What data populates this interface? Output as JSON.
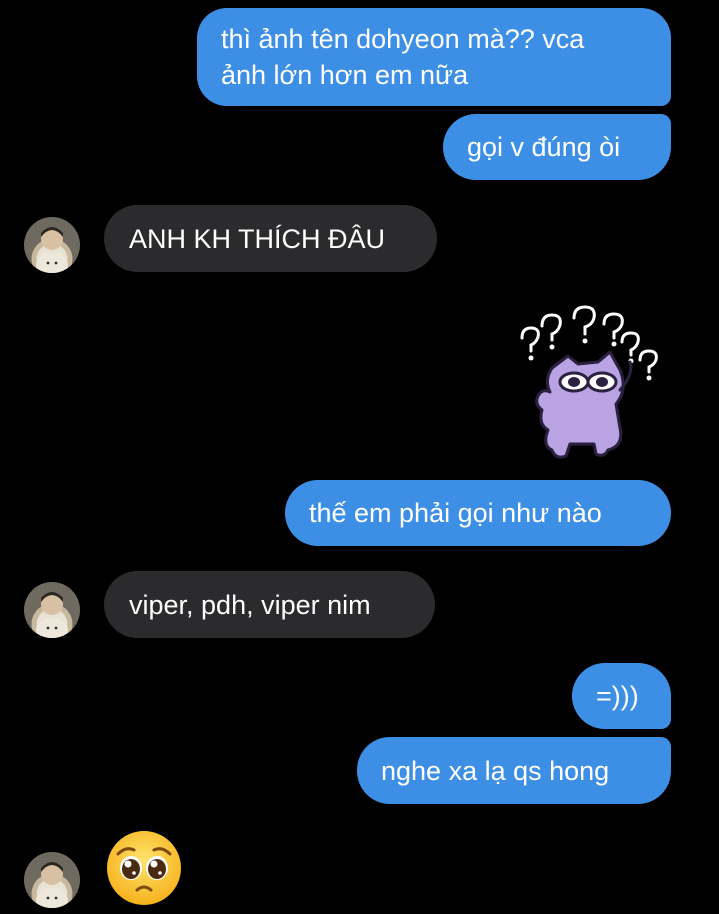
{
  "theme": {
    "background": "#000000",
    "outgoing_bubble": "#3d8fe6",
    "incoming_bubble": "#2b2b2d",
    "text": "#ffffff"
  },
  "messages": [
    {
      "direction": "outgoing",
      "text": "thì ảnh tên dohyeon mà?? vca\nảnh lớn hơn em nữa"
    },
    {
      "direction": "outgoing",
      "text": "gọi v đúng òi"
    },
    {
      "direction": "incoming",
      "text": "ANH KH THÍCH ĐÂU"
    },
    {
      "direction": "outgoing",
      "type": "sticker",
      "sticker": "confused-purple-cat-question-marks"
    },
    {
      "direction": "outgoing",
      "text": "thế em phải gọi như nào"
    },
    {
      "direction": "incoming",
      "text": "viper, pdh, viper nim"
    },
    {
      "direction": "outgoing",
      "text": "=)))"
    },
    {
      "direction": "outgoing",
      "text": "nghe xa lạ qs hong"
    },
    {
      "direction": "incoming",
      "type": "emoji",
      "emoji": "pleading-face"
    }
  ],
  "contact": {
    "avatar": "contact-avatar"
  }
}
